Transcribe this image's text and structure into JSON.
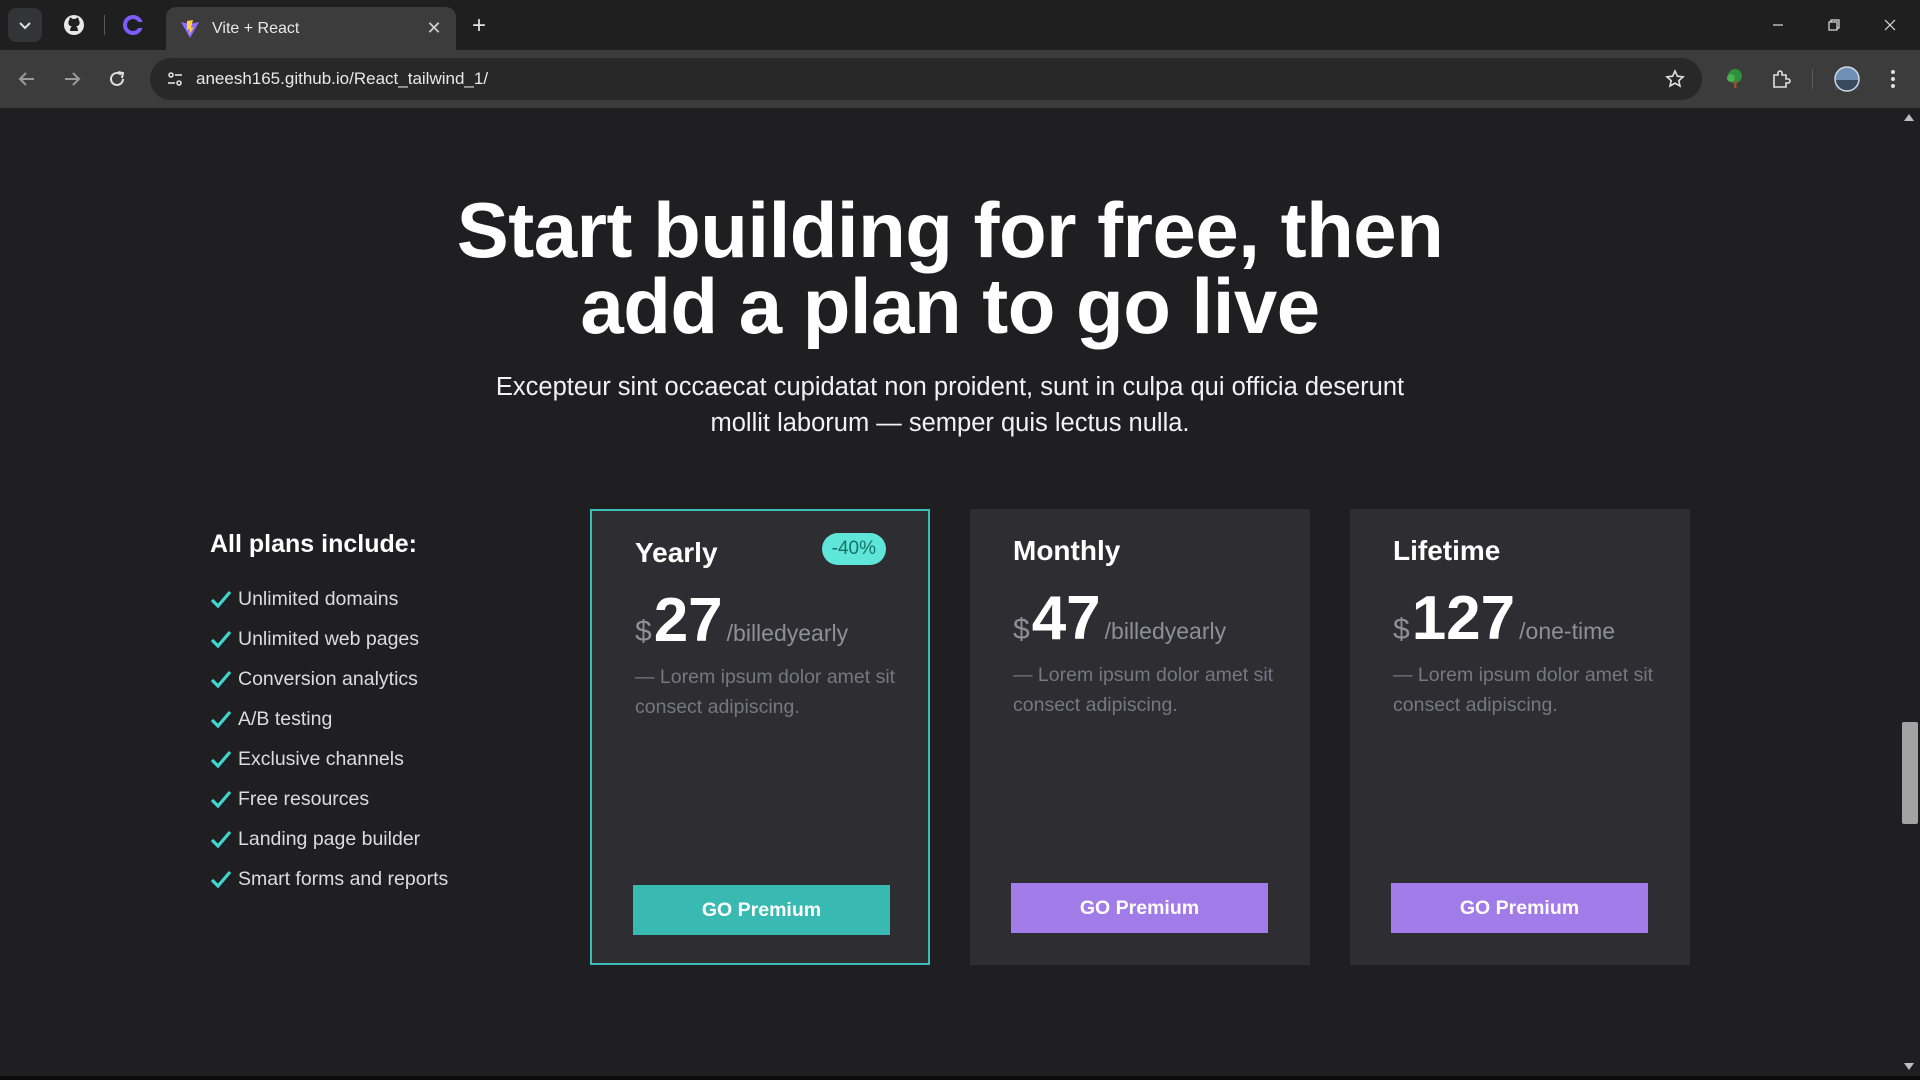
{
  "browser": {
    "tab_title": "Vite + React",
    "url": "aneesh165.github.io/React_tailwind_1/"
  },
  "hero": {
    "title_line1": "Start building for free, then",
    "title_line2": "add a plan to go live",
    "subtitle_line1": "Excepteur sint occaecat cupidatat non proident, sunt in culpa qui officia deserunt",
    "subtitle_line2": "mollit laborum — semper quis lectus nulla."
  },
  "features": {
    "title": "All plans include:",
    "items": [
      "Unlimited domains",
      "Unlimited web pages",
      "Conversion analytics",
      "A/B testing",
      "Exclusive channels",
      "Free resources",
      "Landing page builder",
      "Smart forms and reports"
    ]
  },
  "plans": [
    {
      "name": "Yearly",
      "badge": "-40%",
      "currency": "$",
      "amount": "27",
      "period": "/billedyearly",
      "desc": "— Lorem ipsum dolor amet sit consect adipiscing.",
      "cta": "GO Premium"
    },
    {
      "name": "Monthly",
      "currency": "$",
      "amount": "47",
      "period": "/billedyearly",
      "desc": "— Lorem ipsum dolor amet sit consect adipiscing.",
      "cta": "GO Premium"
    },
    {
      "name": "Lifetime",
      "currency": "$",
      "amount": "127",
      "period": "/one-time",
      "desc": "— Lorem ipsum dolor amet sit consect adipiscing.",
      "cta": "GO Premium"
    }
  ],
  "colors": {
    "accent_teal": "#38b9b1",
    "accent_purple": "#a17be8",
    "badge_bg": "#5ee6d8",
    "check": "#3fd6d0"
  }
}
